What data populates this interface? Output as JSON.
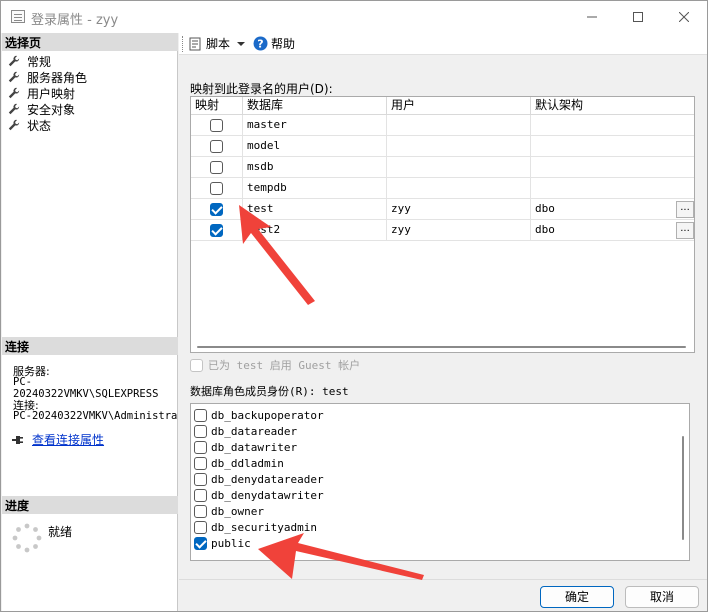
{
  "window": {
    "title": "登录属性 - zyy"
  },
  "left": {
    "select_page_title": "选择页",
    "pages": [
      "常规",
      "服务器角色",
      "用户映射",
      "安全对象",
      "状态"
    ],
    "connection_title": "连接",
    "server_label": "服务器:",
    "server_value": "PC-20240322VMKV\\SQLEXPRESS",
    "conn_label": "连接:",
    "conn_value": "PC-20240322VMKV\\Administrat",
    "view_conn_link": "查看连接属性",
    "progress_title": "进度",
    "progress_status": "就绪"
  },
  "toolbar": {
    "script_label": "脚本",
    "help_label": "帮助"
  },
  "mapping": {
    "label": "映射到此登录名的用户(D):",
    "columns": [
      "映射",
      "数据库",
      "用户",
      "默认架构"
    ],
    "rows": [
      {
        "checked": false,
        "db": "master",
        "user": "",
        "schema": "",
        "has_browse": false
      },
      {
        "checked": false,
        "db": "model",
        "user": "",
        "schema": "",
        "has_browse": false
      },
      {
        "checked": false,
        "db": "msdb",
        "user": "",
        "schema": "",
        "has_browse": false
      },
      {
        "checked": false,
        "db": "tempdb",
        "user": "",
        "schema": "",
        "has_browse": false
      },
      {
        "checked": true,
        "db": "test",
        "user": "zyy",
        "schema": "dbo",
        "has_browse": true
      },
      {
        "checked": true,
        "db": "test2",
        "user": "zyy",
        "schema": "dbo",
        "has_browse": true
      }
    ],
    "browse_label": "..."
  },
  "guest": {
    "label": "已为 test 启用 Guest 帐户",
    "checked": false,
    "enabled": false
  },
  "roles": {
    "label": "数据库角色成员身份(R): test",
    "items": [
      {
        "name": "db_backupoperator",
        "checked": false
      },
      {
        "name": "db_datareader",
        "checked": false
      },
      {
        "name": "db_datawriter",
        "checked": false
      },
      {
        "name": "db_ddladmin",
        "checked": false
      },
      {
        "name": "db_denydatareader",
        "checked": false
      },
      {
        "name": "db_denydatawriter",
        "checked": false
      },
      {
        "name": "db_owner",
        "checked": false
      },
      {
        "name": "db_securityadmin",
        "checked": false
      },
      {
        "name": "public",
        "checked": true
      }
    ]
  },
  "footer": {
    "ok_label": "确定",
    "cancel_label": "取消"
  },
  "colors": {
    "accent": "#0067c0",
    "annotation_arrow": "#f0423a"
  }
}
